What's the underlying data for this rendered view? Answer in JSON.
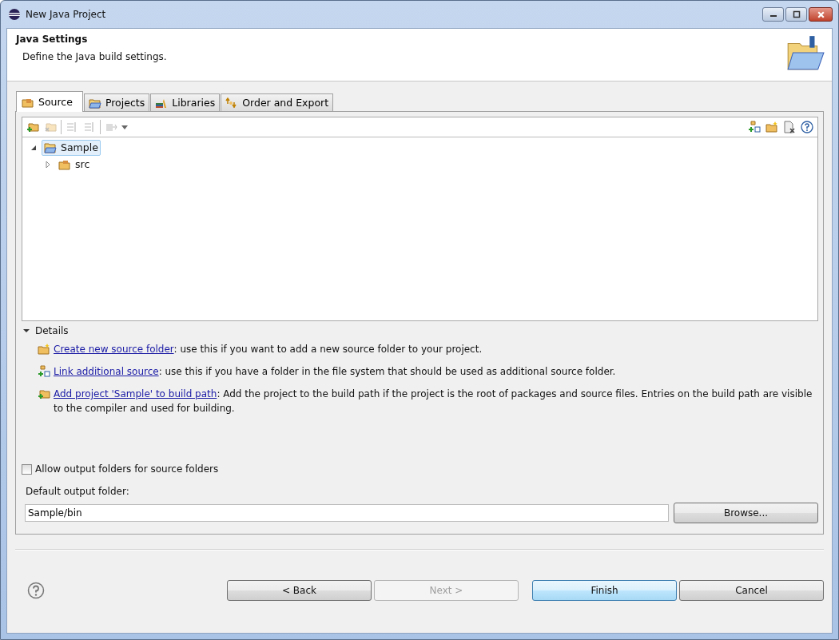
{
  "window": {
    "title": "New Java Project"
  },
  "header": {
    "title": "Java Settings",
    "description": "Define the Java build settings."
  },
  "tabs": [
    {
      "label": "Source",
      "selected": true
    },
    {
      "label": "Projects",
      "selected": false
    },
    {
      "label": "Libraries",
      "selected": false
    },
    {
      "label": "Order and Export",
      "selected": false
    }
  ],
  "toolbar_left": [
    {
      "disabled": false
    },
    {
      "disabled": true
    },
    {
      "disabled": true
    },
    {
      "disabled": true
    },
    {
      "disabled": true
    }
  ],
  "tree": [
    {
      "label": "Sample",
      "kind": "project",
      "expanded": true,
      "selected": true,
      "children": [
        {
          "label": "src",
          "kind": "package",
          "expanded": false,
          "selected": false
        }
      ]
    }
  ],
  "details": {
    "label": "Details",
    "expanded": true,
    "items": [
      {
        "link": "Create new source folder",
        "text": ": use this if you want to add a new source folder to your project."
      },
      {
        "link": "Link additional source",
        "text": ": use this if you have a folder in the file system that should be used as additional source folder."
      },
      {
        "link": "Add project 'Sample' to build path",
        "text": ": Add the project to the build path if the project is the root of packages and source files. Entries on the build path are visible to the compiler and used for building."
      }
    ]
  },
  "allow_output": {
    "label": "Allow output folders for source folders",
    "checked": false
  },
  "output_folder": {
    "label": "Default output folder:",
    "value": "Sample/bin",
    "browse": "Browse..."
  },
  "buttons": [
    {
      "label": "< Back",
      "disabled": false,
      "default": false
    },
    {
      "label": "Next >",
      "disabled": true,
      "default": false
    },
    {
      "label": "Finish",
      "disabled": false,
      "default": true
    },
    {
      "label": "Cancel",
      "disabled": false,
      "default": false
    }
  ]
}
